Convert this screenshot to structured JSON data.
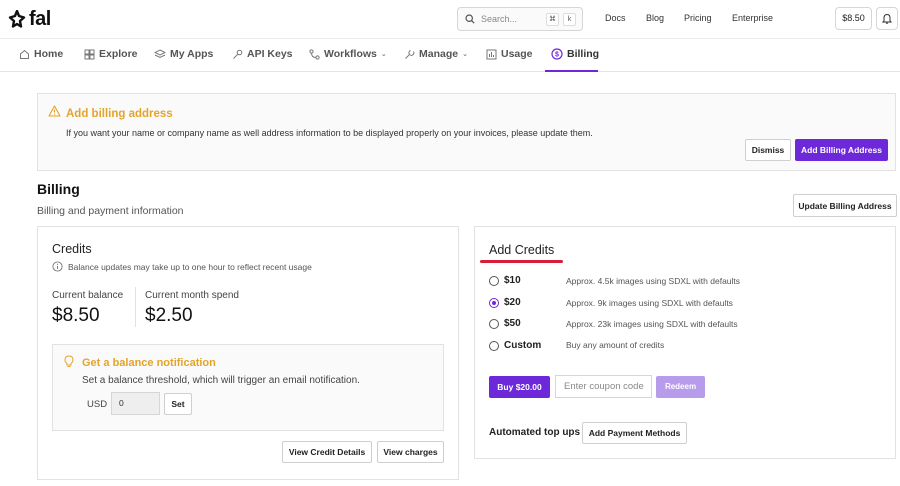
{
  "brand": {
    "name": "fal"
  },
  "search": {
    "placeholder": "Search...",
    "shortcut_keys": [
      "⌘",
      "k"
    ]
  },
  "top_links": [
    "Docs",
    "Blog",
    "Pricing",
    "Enterprise"
  ],
  "account": {
    "balance": "$8.50"
  },
  "nav": {
    "items": [
      {
        "label": "Home",
        "icon": "home-icon"
      },
      {
        "label": "Explore",
        "icon": "grid-icon"
      },
      {
        "label": "My Apps",
        "icon": "layers-icon"
      },
      {
        "label": "API Keys",
        "icon": "key-icon"
      },
      {
        "label": "Workflows",
        "icon": "workflow-icon",
        "dropdown": true
      },
      {
        "label": "Manage",
        "icon": "wrench-icon",
        "dropdown": true
      },
      {
        "label": "Usage",
        "icon": "bar-chart-icon"
      },
      {
        "label": "Billing",
        "icon": "dollar-circle-icon",
        "active": true
      }
    ]
  },
  "alert": {
    "title": "Add billing address",
    "text": "If you want your name or company name as well address information to be displayed properly on your invoices, please update them.",
    "dismiss_label": "Dismiss",
    "add_label": "Add Billing Address",
    "icon": "warning-icon"
  },
  "billing": {
    "title": "Billing",
    "subtitle": "Billing and payment information",
    "update_address_label": "Update Billing Address"
  },
  "credits": {
    "title": "Credits",
    "info": "Balance updates may take up to one hour to reflect recent usage",
    "current_balance_label": "Current balance",
    "current_balance": "$8.50",
    "month_spend_label": "Current month spend",
    "month_spend": "$2.50",
    "notification": {
      "title": "Get a balance notification",
      "text": "Set a balance threshold, which will trigger an email notification.",
      "currency": "USD",
      "value": "0",
      "set_label": "Set"
    },
    "view_details_label": "View Credit Details",
    "view_charges_label": "View charges"
  },
  "add_credits": {
    "title": "Add Credits",
    "options": [
      {
        "label": "$10",
        "desc": "Approx. 4.5k images using SDXL with defaults",
        "selected": false
      },
      {
        "label": "$20",
        "desc": "Approx. 9k images using SDXL with defaults",
        "selected": true
      },
      {
        "label": "$50",
        "desc": "Approx. 23k images using SDXL with defaults",
        "selected": false
      },
      {
        "label": "Custom",
        "desc": "Buy any amount of credits",
        "selected": false
      }
    ],
    "buy_label": "Buy $20.00",
    "coupon_placeholder": "Enter coupon code",
    "redeem_label": "Redeem",
    "auto_topup_label": "Automated top ups",
    "add_payment_label": "Add Payment Methods"
  },
  "colors": {
    "accent": "#6d28d9",
    "warning": "#e3a42a",
    "highlight": "#d91e3a"
  }
}
